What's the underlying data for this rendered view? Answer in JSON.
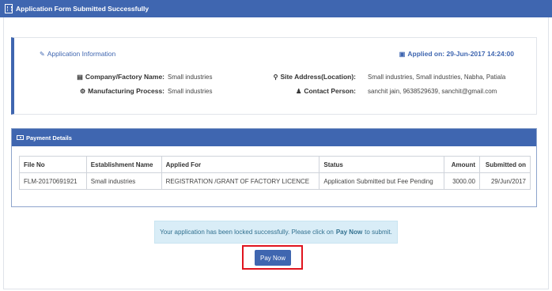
{
  "window": {
    "title": "Application Form Submitted Successfully"
  },
  "application_info": {
    "section_title": "Application Information",
    "applied_on": "Applied on: 29-Jun-2017 14:24:00",
    "company_label": "Company/Factory Name:",
    "company_value": "Small industries",
    "process_label": "Manufacturing Process:",
    "process_value": "Small industries",
    "site_label": "Site Address(Location):",
    "site_value": "Small industries, Small industries, Nabha, Patiala",
    "contact_label": "Contact Person:",
    "contact_value": "sanchit jain, 9638529639, sanchit@gmail.com"
  },
  "payment": {
    "title": "Payment Details",
    "columns": [
      "File No",
      "Establishment Name",
      "Applied For",
      "Status",
      "Amount",
      "Submitted on"
    ],
    "rows": [
      [
        "FLM-20170691921",
        "Small industries",
        "REGISTRATION /GRANT OF FACTORY LICENCE",
        "Application Submitted but Fee Pending",
        "3000.00",
        "29/Jun/2017"
      ]
    ]
  },
  "notice": {
    "before": "Your application has been locked successfully. Please click on",
    "bold": "Pay Now",
    "after": "to submit."
  },
  "actions": {
    "pay_now": "Pay Now"
  },
  "colors": {
    "primary": "#3f66b0",
    "alert_bg": "#d9edf7",
    "alert_text": "#31708f",
    "highlight": "#e0141e"
  }
}
